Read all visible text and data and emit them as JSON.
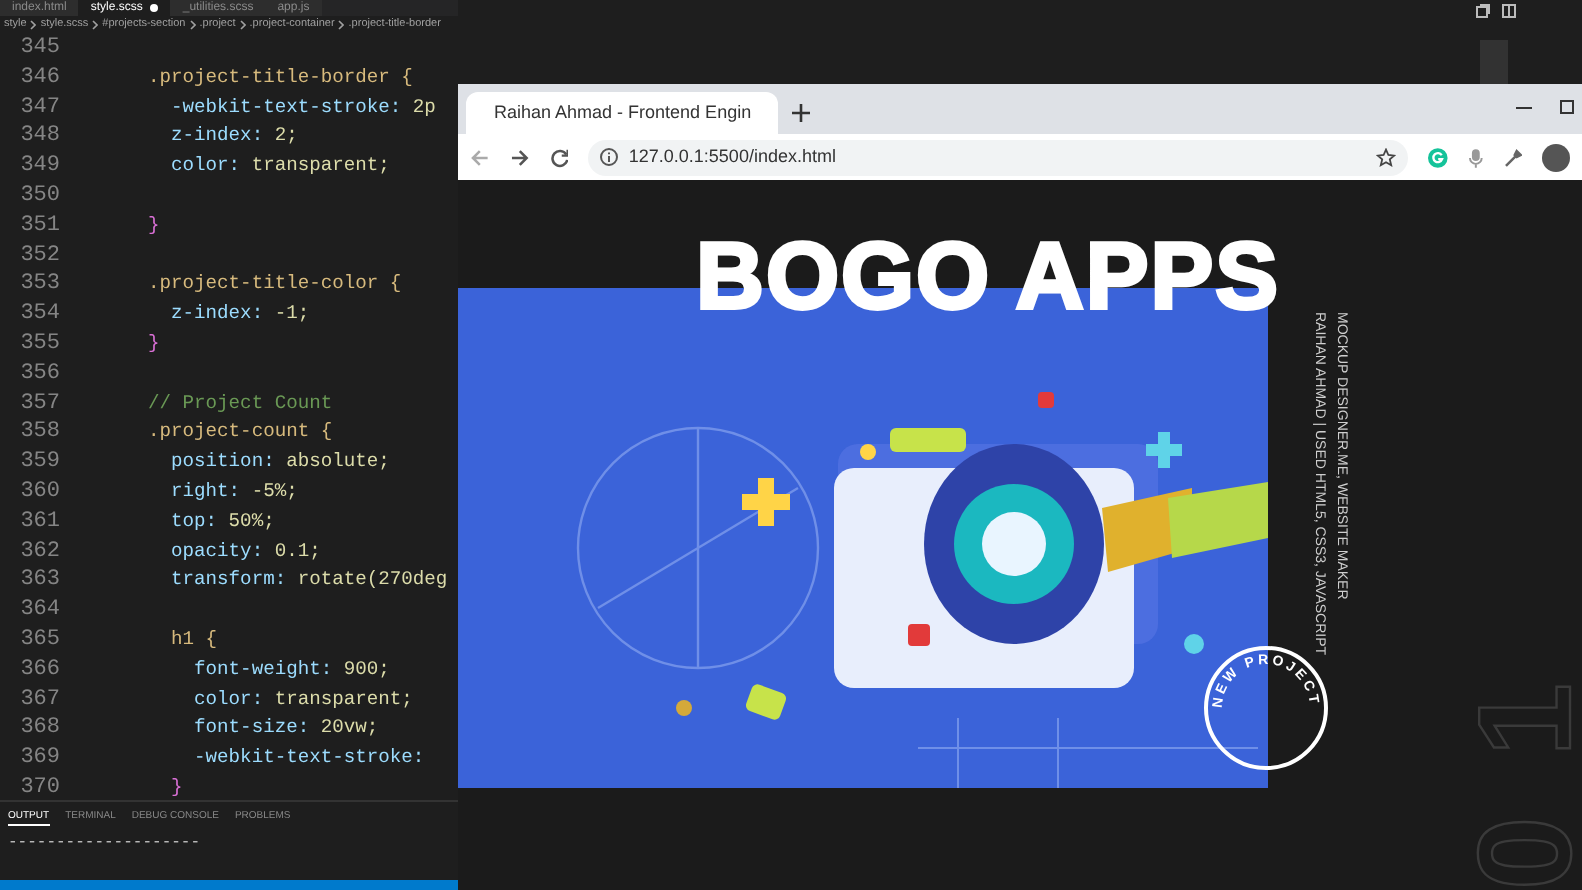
{
  "editor": {
    "tabs": [
      {
        "label": "index.html",
        "selected": false,
        "modified": false
      },
      {
        "label": "style.scss",
        "selected": true,
        "modified": true
      },
      {
        "label": "_utilities.scss",
        "selected": false,
        "modified": false
      },
      {
        "label": "app.js",
        "selected": false,
        "modified": false
      }
    ],
    "breadcrumb": [
      "style",
      "style.scss",
      "#projects-section",
      ".project",
      ".project-container",
      ".project-title-border"
    ],
    "lines": [
      {
        "number": "345"
      },
      {
        "number": "346",
        "kind": "selector",
        "text": ".project-title-border {"
      },
      {
        "number": "347",
        "kind": "property",
        "text": "  -webkit-text-stroke: 2p"
      },
      {
        "number": "348",
        "kind": "property",
        "text": "  z-index: 2;"
      },
      {
        "number": "349",
        "kind": "property",
        "text": "  color: transparent;"
      },
      {
        "number": "350"
      },
      {
        "number": "351",
        "kind": "brace",
        "text": "}"
      },
      {
        "number": "352"
      },
      {
        "number": "353",
        "kind": "selector",
        "text": ".project-title-color {"
      },
      {
        "number": "354",
        "kind": "property",
        "text": "  z-index: -1;"
      },
      {
        "number": "355",
        "kind": "brace",
        "text": "}"
      },
      {
        "number": "356"
      },
      {
        "number": "357",
        "kind": "comment",
        "text": "// Project Count"
      },
      {
        "number": "358",
        "kind": "selector",
        "text": ".project-count {"
      },
      {
        "number": "359",
        "kind": "property",
        "text": "  position: absolute;"
      },
      {
        "number": "360",
        "kind": "property",
        "text": "  right: -5%;"
      },
      {
        "number": "361",
        "kind": "property",
        "text": "  top: 50%;"
      },
      {
        "number": "362",
        "kind": "property",
        "text": "  opacity: 0.1;"
      },
      {
        "number": "363",
        "kind": "property",
        "text": "  transform: rotate(270deg"
      },
      {
        "number": "364"
      },
      {
        "number": "365",
        "kind": "selector",
        "text": "  h1 {"
      },
      {
        "number": "366",
        "kind": "property",
        "text": "    font-weight: 900;"
      },
      {
        "number": "367",
        "kind": "property",
        "text": "    color: transparent;"
      },
      {
        "number": "368",
        "kind": "property",
        "text": "    font-size: 20vw;"
      },
      {
        "number": "369",
        "kind": "property",
        "text": "    -webkit-text-stroke:"
      },
      {
        "number": "370",
        "kind": "brace",
        "text": "  }"
      }
    ],
    "panel": {
      "tabs": [
        {
          "label": "OUTPUT",
          "selected": true
        },
        {
          "label": "TERMINAL",
          "selected": false
        },
        {
          "label": "DEBUG CONSOLE",
          "selected": false
        },
        {
          "label": "PROBLEMS",
          "selected": false
        }
      ],
      "output": "--------------------"
    }
  },
  "browser": {
    "tab_title": "Raihan Ahmad - Frontend Engin",
    "url": "127.0.0.1:5500/index.html",
    "page": {
      "title": "BOGO APPS",
      "side_text": [
        "MOCKUP DESIGNER.ME, WEBSITE MAKER",
        "RAIHAN AHMAD | USED HTML5, CSS3, JAVASCRIPT"
      ],
      "badge": "NEW PROJECT",
      "count": "01"
    }
  }
}
